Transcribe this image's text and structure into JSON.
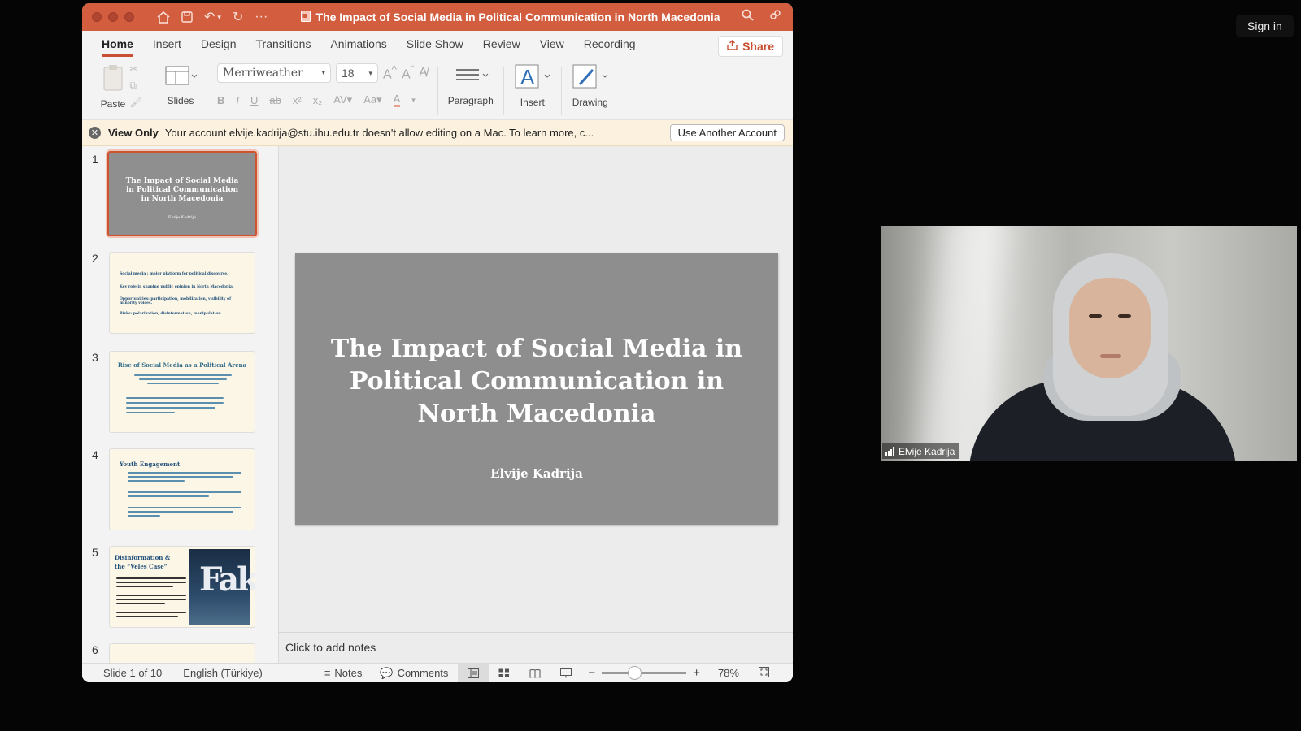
{
  "screen": {
    "signin_label": "Sign in"
  },
  "window": {
    "title": "The Impact of Social Media in Political Communication in North Macedonia",
    "accent_color": "#d35e3f"
  },
  "tabs": [
    "Home",
    "Insert",
    "Design",
    "Transitions",
    "Animations",
    "Slide Show",
    "Review",
    "View",
    "Recording"
  ],
  "share_label": "Share",
  "ribbon": {
    "paste_label": "Paste",
    "slides_label": "Slides",
    "font_name": "Merriweather",
    "font_size": "18",
    "paragraph_label": "Paragraph",
    "insert_label": "Insert",
    "drawing_label": "Drawing"
  },
  "infobar": {
    "label": "View Only",
    "message": "Your account elvije.kadrija@stu.ihu.edu.tr doesn't allow editing on a Mac. To learn more, c...",
    "button": "Use Another Account"
  },
  "thumbnails": {
    "numbers": [
      "1",
      "2",
      "3",
      "4",
      "5",
      "6"
    ],
    "slide1_title": "The Impact of Social Media in Political Communication in North Macedonia",
    "slide1_author": "Elvije Kadrija",
    "slide2_bullets": [
      "Social media : major platform for political discourse.",
      "Key role in shaping public opinion in North Macedonia.",
      "Opportunities: participation, mobilization, visibility of minority voices.",
      "Risks: polarization, disinformation, manipulation."
    ],
    "slide3_title": "Rise of Social Media as a Political Arena",
    "slide4_title": "Youth Engagement",
    "slide5_title": "Disinformation & the “Veles Case”",
    "slide5_image_text": "Fake"
  },
  "slide": {
    "title": "The Impact of Social Media in Political Communication in North Macedonia",
    "author": "Elvije Kadrija"
  },
  "notes_placeholder": "Click to add notes",
  "statusbar": {
    "slide_info": "Slide 1 of 10",
    "language": "English (Türkiye)",
    "notes_label": "Notes",
    "comments_label": "Comments",
    "zoom": "78%",
    "zoom_level": 0.39
  },
  "video": {
    "participant_name": "Elvije Kadrija"
  }
}
